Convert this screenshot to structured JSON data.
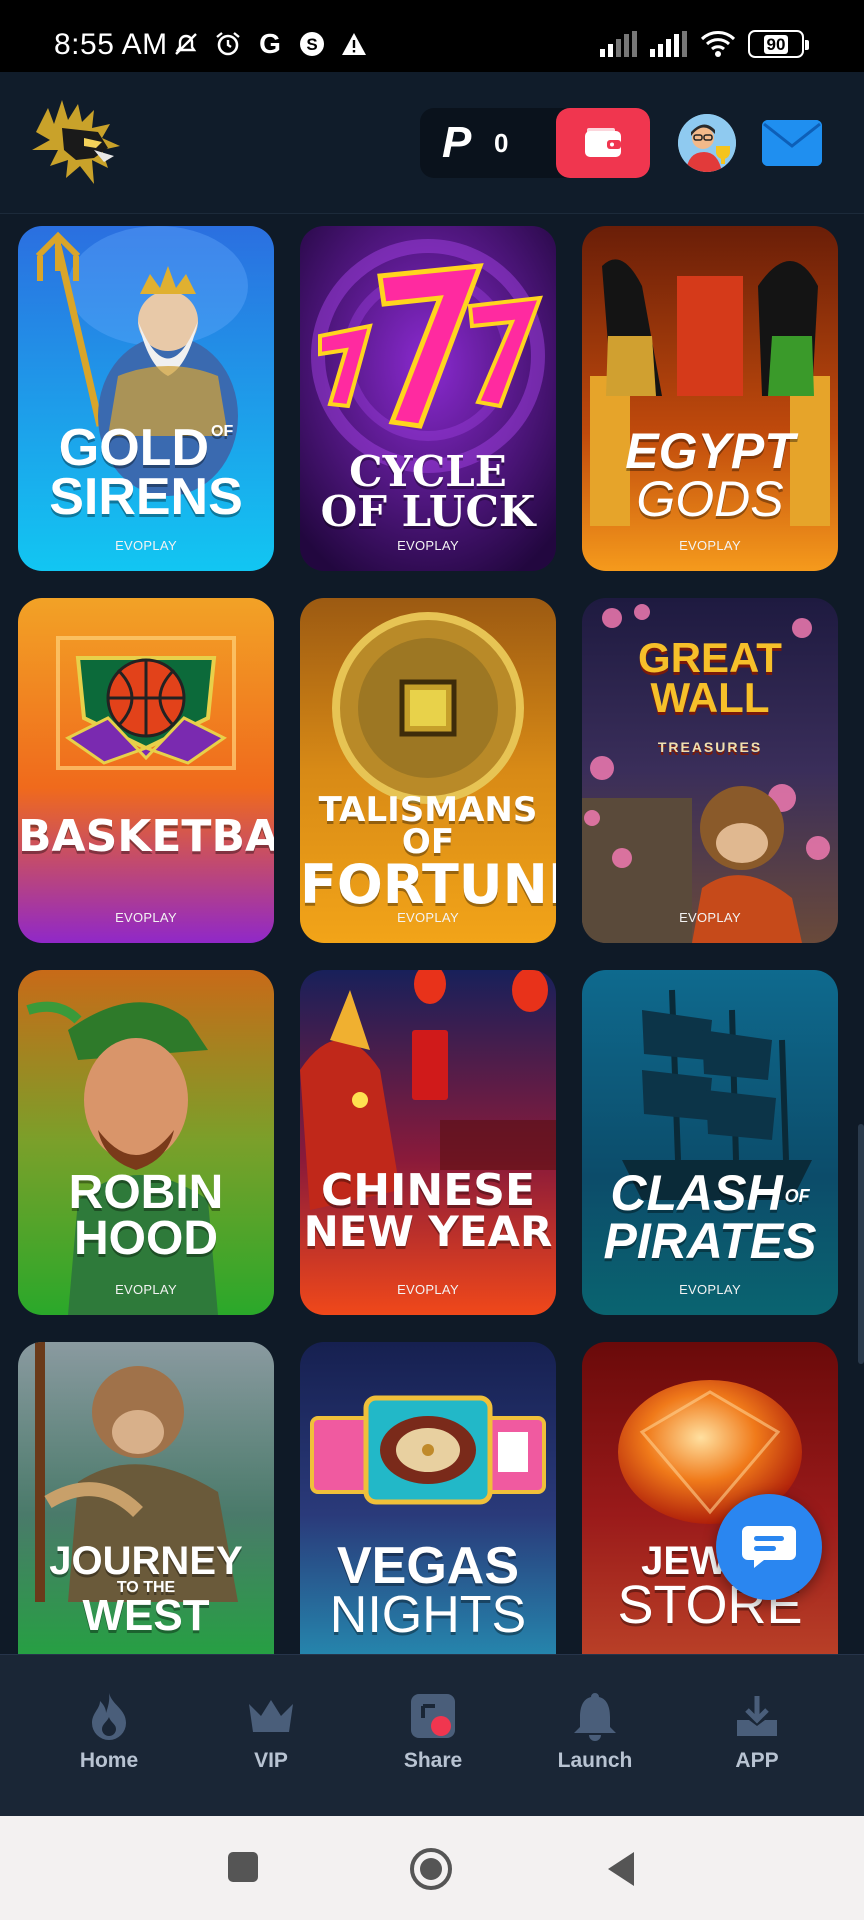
{
  "status_bar": {
    "time": "8:55 AM",
    "battery": "90",
    "left_icons": [
      "mute-alarm-icon",
      "alarm-icon",
      "google-icon",
      "shazam-icon",
      "warning-icon"
    ],
    "right_icons": [
      "signal-icon",
      "signal-icon",
      "wifi-icon",
      "battery-icon"
    ]
  },
  "header": {
    "balance_symbol": "P",
    "balance_value": "0",
    "icons": [
      "logo-icon",
      "wallet-icon",
      "avatar",
      "mail-icon"
    ]
  },
  "games": [
    {
      "title": "GOLD OF SIRENS",
      "line1": "GOLD",
      "of": "OF",
      "line2": "SIRENS",
      "provider": "EVOPLAY",
      "bg_top": "#2b8fe6",
      "bg_bottom": "#10c4f0"
    },
    {
      "title": "CYCLE OF LUCK",
      "line1": "CYCLE",
      "line2": "OF LUCK",
      "provider": "EVOPLAY",
      "bg_top": "#5a1a9c",
      "bg_bottom": "#2c0b55"
    },
    {
      "title": "EGYPT GODS",
      "line1": "EGYPT",
      "line2": "GODS",
      "provider": "EVOPLAY",
      "bg_top": "#8a3a0a",
      "bg_bottom": "#f08a14"
    },
    {
      "title": "BASKETBALL",
      "line1": "BASKETBALL",
      "provider": "EVOPLAY",
      "bg_top": "#f08a1c",
      "bg_bottom": "#9c30c6"
    },
    {
      "title": "TALISMANS OF FORTUNE",
      "line1": "TALISMANS OF",
      "line2": "FORTUNE",
      "provider": "EVOPLAY",
      "bg_top": "#b8721a",
      "bg_bottom": "#f0a214"
    },
    {
      "title": "THE GREAT WALL TREASURES",
      "line1": "GREAT",
      "line2": "WALL",
      "sub": "TREASURES",
      "provider": "EVOPLAY",
      "bg_top": "#2a1e48",
      "bg_bottom": "#5a3a2c"
    },
    {
      "title": "ROBIN HOOD",
      "line1": "ROBIN",
      "line2": "HOOD",
      "provider": "EVOPLAY",
      "bg_top": "#c46d18",
      "bg_bottom": "#3ca82a"
    },
    {
      "title": "CHINESE NEW YEAR",
      "line1": "CHINESE",
      "line2": "NEW YEAR",
      "provider": "EVOPLAY",
      "bg_top": "#1e2a6c",
      "bg_bottom": "#e0321c"
    },
    {
      "title": "CLASH OF PIRATES",
      "line1": "CLASH",
      "of": "OF",
      "line2": "PIRATES",
      "provider": "EVOPLAY",
      "bg_top": "#0c4c6e",
      "bg_bottom": "#0c6a78"
    },
    {
      "title": "JOURNEY TO THE WEST",
      "line1": "JOURNEY",
      "mid": "TO THE",
      "line2": "WEST",
      "provider": "",
      "bg_top": "#6a7a7a",
      "bg_bottom": "#22a83c"
    },
    {
      "title": "VEGAS NIGHTS",
      "line1": "VEGAS",
      "line2": "NIGHTS",
      "provider": "",
      "bg_top": "#1c2a5c",
      "bg_bottom": "#2496b8"
    },
    {
      "title": "JEWELRY STORE",
      "line1": "JEWEL",
      "line2": "STORE",
      "provider": "",
      "bg_top": "#7a1212",
      "bg_bottom": "#c63a2a"
    }
  ],
  "bottom_nav": [
    {
      "label": "Home",
      "icon": "flame-icon"
    },
    {
      "label": "VIP",
      "icon": "crown-icon"
    },
    {
      "label": "Share",
      "icon": "share-icon"
    },
    {
      "label": "Launch",
      "icon": "bell-icon"
    },
    {
      "label": "APP",
      "icon": "download-icon"
    }
  ],
  "colors": {
    "background": "#0f1a27",
    "accent_red": "#f0364f",
    "accent_blue": "#2a86f0",
    "nav_label": "#b8c3d2"
  }
}
